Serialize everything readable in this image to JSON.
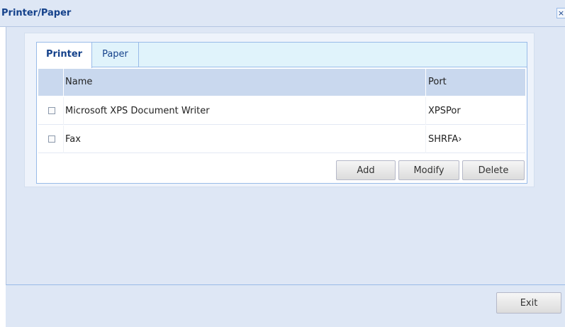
{
  "window": {
    "title": "Printer/Paper",
    "close_glyph": "×"
  },
  "tabs": [
    {
      "label": "Printer",
      "active": true
    },
    {
      "label": "Paper",
      "active": false
    }
  ],
  "printer_grid": {
    "columns": [
      {
        "label": ""
      },
      {
        "label": "Name"
      },
      {
        "label": "Port"
      }
    ],
    "rows": [
      {
        "checked": false,
        "name": "Microsoft XPS Document Writer",
        "port": "XPSPor"
      },
      {
        "checked": false,
        "name": "Fax",
        "port": "SHRFA›"
      }
    ]
  },
  "grid_buttons": {
    "add": "Add",
    "modify": "Modify",
    "delete": "Delete"
  },
  "footer": {
    "exit": "Exit"
  },
  "colors": {
    "title_text": "#15428b",
    "window_bg": "#dee7f5",
    "header_bg": "#c9d8ee",
    "tabbar_bg": "#e0f3fb"
  }
}
